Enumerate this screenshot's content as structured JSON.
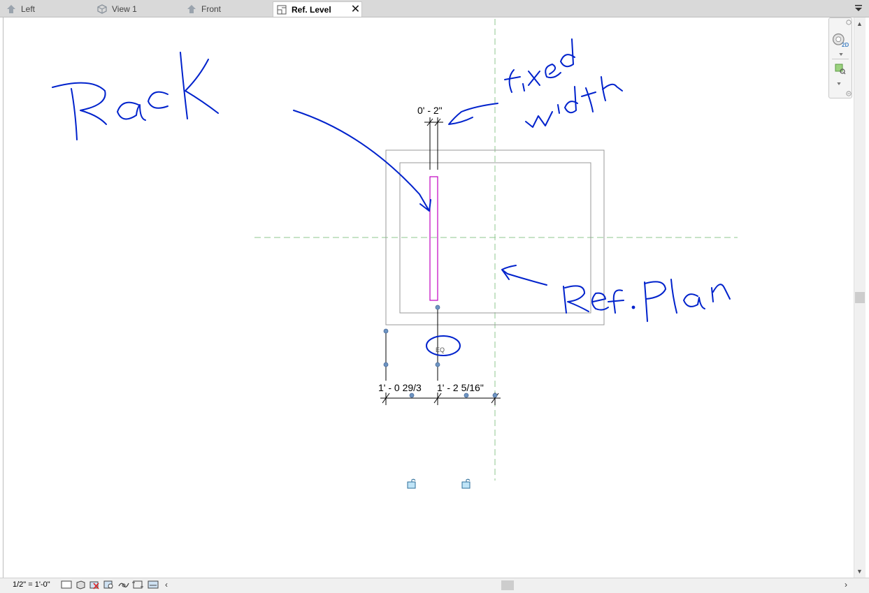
{
  "tabs": [
    {
      "label": "Left",
      "icon": "elevation-view-icon",
      "active": false
    },
    {
      "label": "View 1",
      "icon": "3d-view-icon",
      "active": false
    },
    {
      "label": "Front",
      "icon": "elevation-view-icon",
      "active": false
    },
    {
      "label": "Ref. Level",
      "icon": "floor-plan-icon",
      "active": true
    }
  ],
  "close_glyph": "✕",
  "drawing": {
    "dim_top": "0' - 2\"",
    "dim_bottom_left": "1' - 0 29/3",
    "dim_bottom_right": "1' - 2 5/16\"",
    "eq_label": "EQ",
    "handwritten_notes": [
      "Rack",
      "fixed width",
      "Ref. Plan"
    ],
    "colors": {
      "reference_plane": "#8fc78f",
      "rack_outline": "#c000c0",
      "annotation_ink": "#0022cc",
      "boundary": "#999999",
      "grip": "#6d94c2"
    }
  },
  "navbar": {
    "mode": "2D"
  },
  "status": {
    "scale": "1/2\" = 1'-0\"",
    "icons": [
      "detail-level-icon",
      "visual-style-icon",
      "sun-path-off-icon",
      "shadows-off-icon",
      "crop-view-icon",
      "show-crop-region-icon",
      "temporary-hide-icon",
      "reveal-hidden-icon"
    ]
  }
}
